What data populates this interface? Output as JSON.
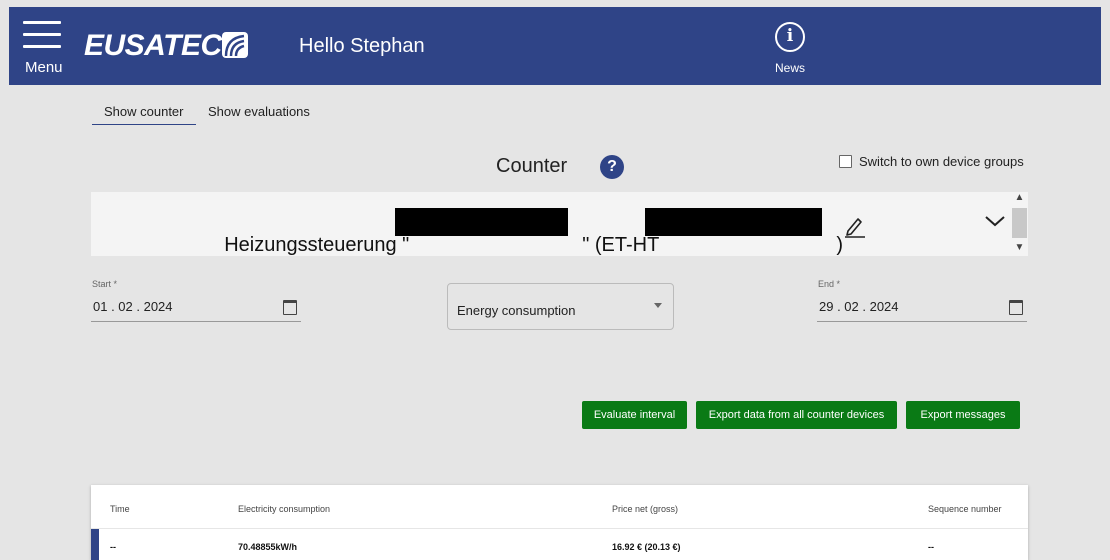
{
  "header": {
    "menu_label": "Menu",
    "logo_text": "EUSATEC",
    "greeting": "Hello Stephan",
    "news_label": "News",
    "bg_color": "#2f4487"
  },
  "tabs": [
    {
      "label": "Show counter",
      "active": true
    },
    {
      "label": "Show evaluations",
      "active": false
    }
  ],
  "section": {
    "title": "Counter",
    "help_glyph": "?",
    "switch_label": "Switch to own device groups"
  },
  "device": {
    "prefix": "Heizungssteuerung \"",
    "middle": "\" (ET-HT",
    "suffix": ")"
  },
  "filters": {
    "start_label": "Start *",
    "start_value": "01 . 02 . 2024",
    "mode_value": "Energy consumption",
    "end_label": "End *",
    "end_value": "29 . 02 . 2024"
  },
  "actions": {
    "evaluate": "Evaluate interval",
    "export_all": "Export data from all counter devices",
    "export_messages": "Export messages",
    "color": "#0a7a15"
  },
  "table": {
    "headers": [
      "Time",
      "Electricity consumption",
      "Price net (gross)",
      "Sequence number"
    ],
    "rows": [
      [
        "--",
        "70.48855kW/h",
        "16.92 € (20.13 €)",
        "--"
      ]
    ]
  }
}
